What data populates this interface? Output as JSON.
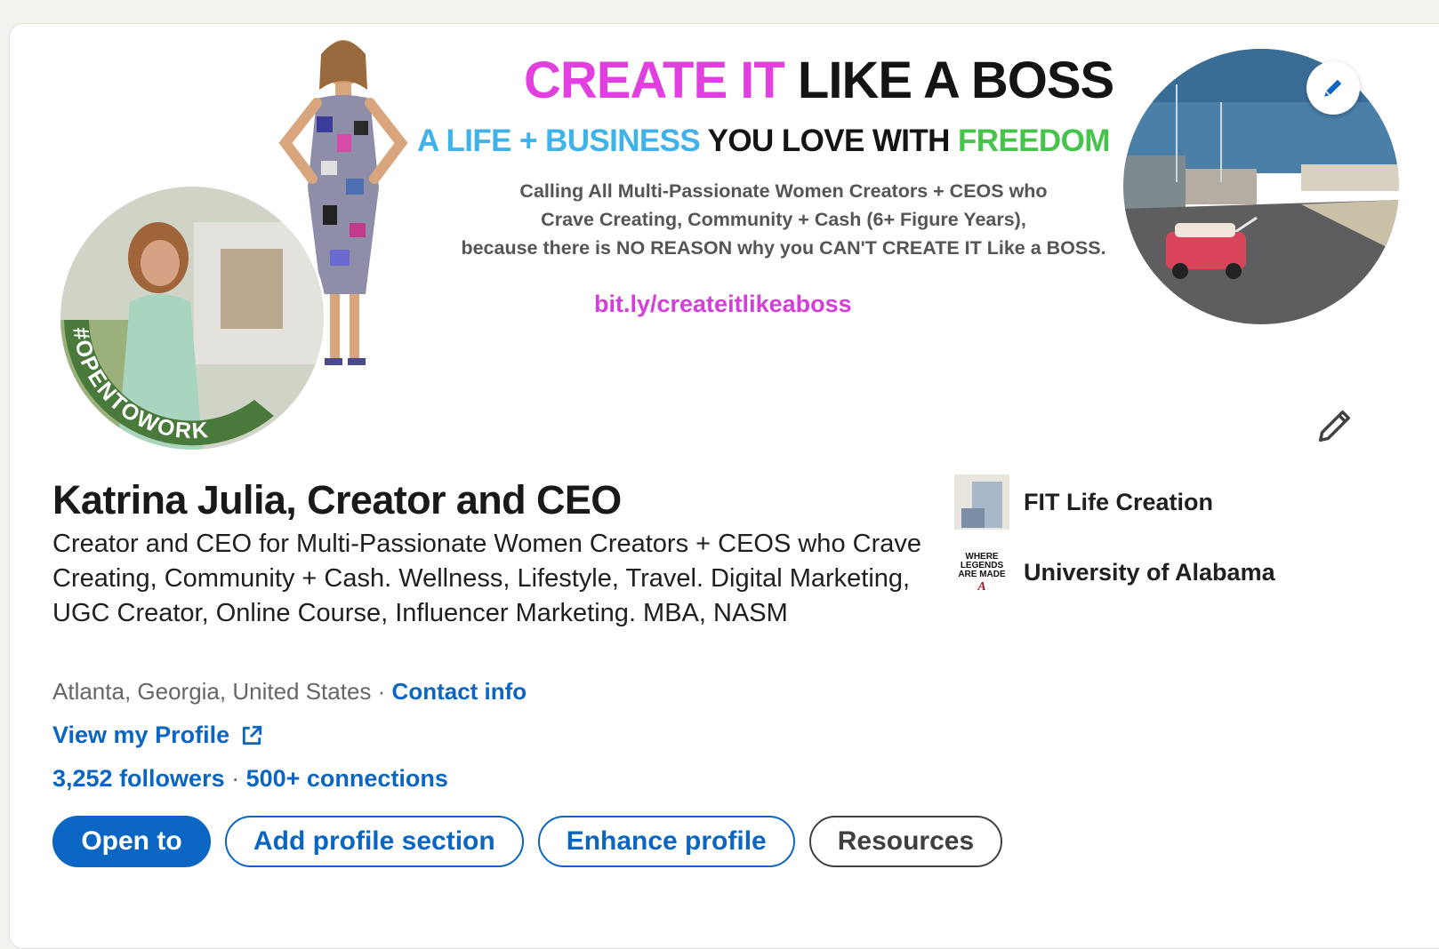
{
  "banner": {
    "headline_part1": "CREATE IT",
    "headline_part2": " LIKE A BOSS",
    "subhead_part1": "A LIFE + BUSINESS",
    "subhead_part2": " YOU LOVE WITH ",
    "subhead_part3": "FREEDOM",
    "tagline_line1": "Calling All Multi-Passionate Women Creators + CEOS who",
    "tagline_line2": "Crave Creating, Community + Cash (6+ Figure Years),",
    "tagline_line3": "because there is NO REASON why you CAN'T CREATE IT Like a BOSS.",
    "link": "bit.ly/createitlikeaboss",
    "edit_icon": "pencil-icon"
  },
  "avatar": {
    "badge_text": "#OPENTOWORK",
    "badge_color": "#4a7a3b"
  },
  "profile": {
    "name": "Katrina Julia, Creator and CEO",
    "headline": "Creator and CEO for Multi-Passionate Women Creators + CEOS who Crave Creating, Community + Cash. Wellness, Lifestyle, Travel. Digital Marketing, UGC Creator, Online Course, Influencer Marketing. MBA, NASM",
    "location": "Atlanta, Georgia, United States",
    "separator": " · ",
    "contact_info": "Contact info",
    "view_profile": "View my Profile",
    "followers": "3,252 followers",
    "connections": "500+ connections"
  },
  "buttons": {
    "open_to": "Open to",
    "add_section": "Add profile section",
    "enhance": "Enhance profile",
    "resources": "Resources"
  },
  "orgs": {
    "company": "FIT Life Creation",
    "school": "University of Alabama",
    "school_logo_text": [
      "WHERE",
      "LEGENDS",
      "ARE MADE",
      "A"
    ]
  },
  "colors": {
    "link_blue": "#0a66c2",
    "banner_pink": "#e23fe0",
    "banner_blue": "#3fb2e9",
    "banner_green": "#44c54a"
  }
}
